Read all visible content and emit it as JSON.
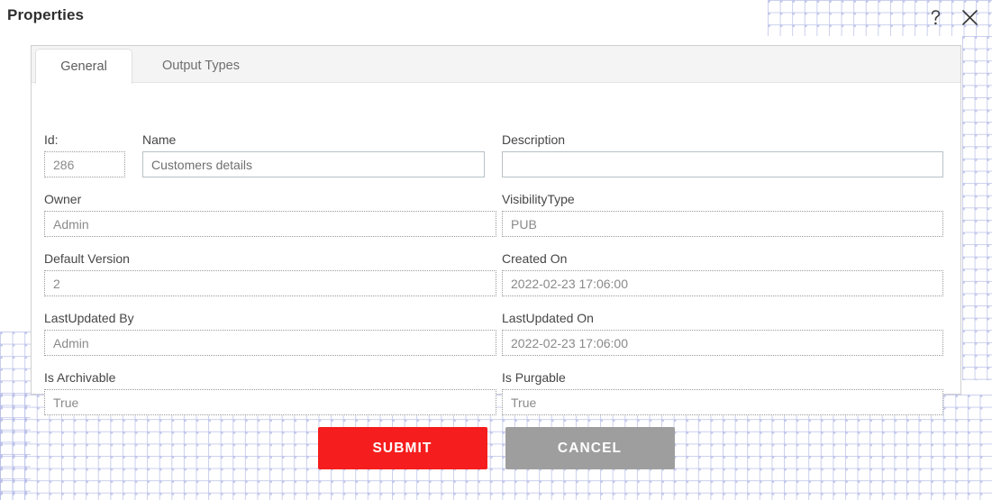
{
  "dialog": {
    "title": "Properties",
    "help_icon": "question-mark-icon",
    "close_icon": "close-x-icon"
  },
  "tabs": [
    {
      "id": "general",
      "label": "General",
      "active": true
    },
    {
      "id": "output-types",
      "label": "Output Types",
      "active": false
    }
  ],
  "form": {
    "fields": [
      {
        "key": "id",
        "label": "Id:",
        "value": "286",
        "readonly": true,
        "placeholder": ""
      },
      {
        "key": "name",
        "label": "Name",
        "value": "Customers details",
        "readonly": false,
        "placeholder": ""
      },
      {
        "key": "description",
        "label": "Description",
        "value": "",
        "readonly": false,
        "placeholder": ""
      },
      {
        "key": "owner",
        "label": "Owner",
        "value": "Admin",
        "readonly": true,
        "placeholder": ""
      },
      {
        "key": "visibility_type",
        "label": "VisibilityType",
        "value": "PUB",
        "readonly": true,
        "placeholder": ""
      },
      {
        "key": "default_version",
        "label": "Default Version",
        "value": "2",
        "readonly": true,
        "placeholder": ""
      },
      {
        "key": "created_on",
        "label": "Created On",
        "value": "2022-02-23 17:06:00",
        "readonly": true,
        "placeholder": ""
      },
      {
        "key": "lastupdated_by",
        "label": "LastUpdated By",
        "value": "Admin",
        "readonly": true,
        "placeholder": ""
      },
      {
        "key": "lastupdated_on",
        "label": "LastUpdated On",
        "value": "2022-02-23 17:06:00",
        "readonly": true,
        "placeholder": ""
      },
      {
        "key": "is_archivable",
        "label": "Is Archivable",
        "value": "True",
        "readonly": true,
        "placeholder": ""
      },
      {
        "key": "is_purgable",
        "label": "Is Purgable",
        "value": "True",
        "readonly": true,
        "placeholder": ""
      }
    ]
  },
  "actions": {
    "submit_label": "SUBMIT",
    "cancel_label": "CANCEL"
  },
  "colors": {
    "submit": "#f51d1d",
    "cancel": "#9e9e9e",
    "pattern_dot": "#aab2e4",
    "panel_border": "#cfcfcf",
    "tab_bar": "#f4f4f4"
  }
}
